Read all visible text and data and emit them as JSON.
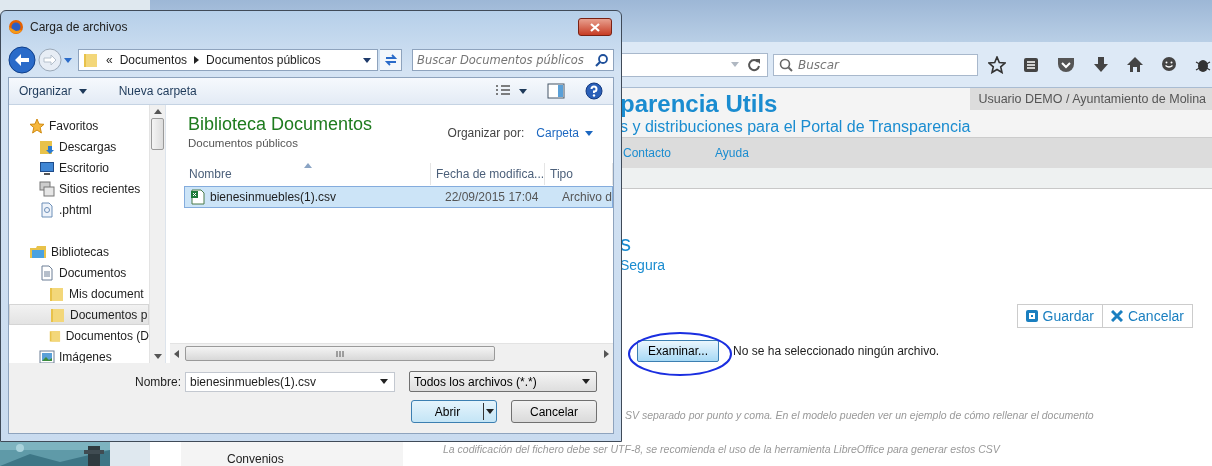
{
  "browser": {
    "search": {
      "placeholder": "Buscar"
    }
  },
  "site": {
    "title": "parencia Utils",
    "subtitle": "s y distribuciones para el Portal de Transparencia",
    "user": "Usuario DEMO / Ayuntamiento de Molina",
    "nav": [
      {
        "label": "Contacto"
      },
      {
        "label": "Ayuda"
      }
    ],
    "sidebar": [
      {
        "label": "Convenios"
      }
    ]
  },
  "form": {
    "heading": "s",
    "subheading": "Segura",
    "actions": [
      {
        "label": "Guardar",
        "kind": "save"
      },
      {
        "label": "Cancelar",
        "kind": "cancel"
      }
    ],
    "file_input": {
      "button": "Examinar...",
      "status": "No se ha seleccionado ningún archivo.",
      "circled": true
    },
    "notes": [
      "SV separado por punto y coma. En el modelo pueden ver un ejemplo de cómo rellenar el documento",
      "La codificación del fichero debe ser UTF-8, se recomienda el uso de la herramienta LibreOffice para generar estos CSV"
    ]
  },
  "dialog": {
    "title": "Carga de archivos",
    "breadcrumb": {
      "overflow": "«",
      "items": [
        "Documentos",
        "Documentos públicos"
      ]
    },
    "search": {
      "placeholder": "Buscar Documentos públicos"
    },
    "toolbar": [
      {
        "label": "Organizar",
        "kind": "menu"
      },
      {
        "label": "Nueva carpeta",
        "kind": "button"
      }
    ],
    "nav_tree": [
      {
        "label": "Favoritos",
        "kind": "star",
        "selected": false,
        "children": [
          {
            "label": "Descargas",
            "kind": "downloads",
            "selected": false
          },
          {
            "label": "Escritorio",
            "kind": "desktop",
            "selected": false
          },
          {
            "label": "Sitios recientes",
            "kind": "recent",
            "selected": false
          },
          {
            "label": ".phtml",
            "kind": "file",
            "selected": false
          }
        ]
      },
      {
        "label": "Bibliotecas",
        "kind": "library",
        "selected": false,
        "children": [
          {
            "label": "Documentos",
            "kind": "documents",
            "selected": false,
            "children": [
              {
                "label": "Mis document",
                "kind": "folder",
                "selected": false
              },
              {
                "label": "Documentos p",
                "kind": "folder",
                "selected": true
              },
              {
                "label": "Documentos (D",
                "kind": "folder",
                "selected": false
              }
            ]
          },
          {
            "label": "Imágenes",
            "kind": "pictures",
            "selected": false
          }
        ]
      }
    ],
    "library": {
      "title": "Biblioteca Documentos",
      "subtitle": "Documentos públicos",
      "arrange_label": "Organizar por:",
      "arrange_value": "Carpeta"
    },
    "columns": [
      {
        "label": "Nombre",
        "sorted": true
      },
      {
        "label": "Fecha de modifica...",
        "sorted": false
      },
      {
        "label": "Tipo",
        "sorted": false
      }
    ],
    "files": [
      {
        "name": "bienesinmuebles(1).csv",
        "modified": "22/09/2015 17:04",
        "type": "Archivo d",
        "selected": true
      }
    ],
    "filename": {
      "label": "Nombre:",
      "value": "bienesinmuebles(1).csv"
    },
    "filter": {
      "value": "Todos los archivos (*.*)"
    },
    "buttons": [
      {
        "label": "Abrir",
        "kind": "split"
      },
      {
        "label": "Cancelar",
        "kind": "plain"
      }
    ]
  }
}
